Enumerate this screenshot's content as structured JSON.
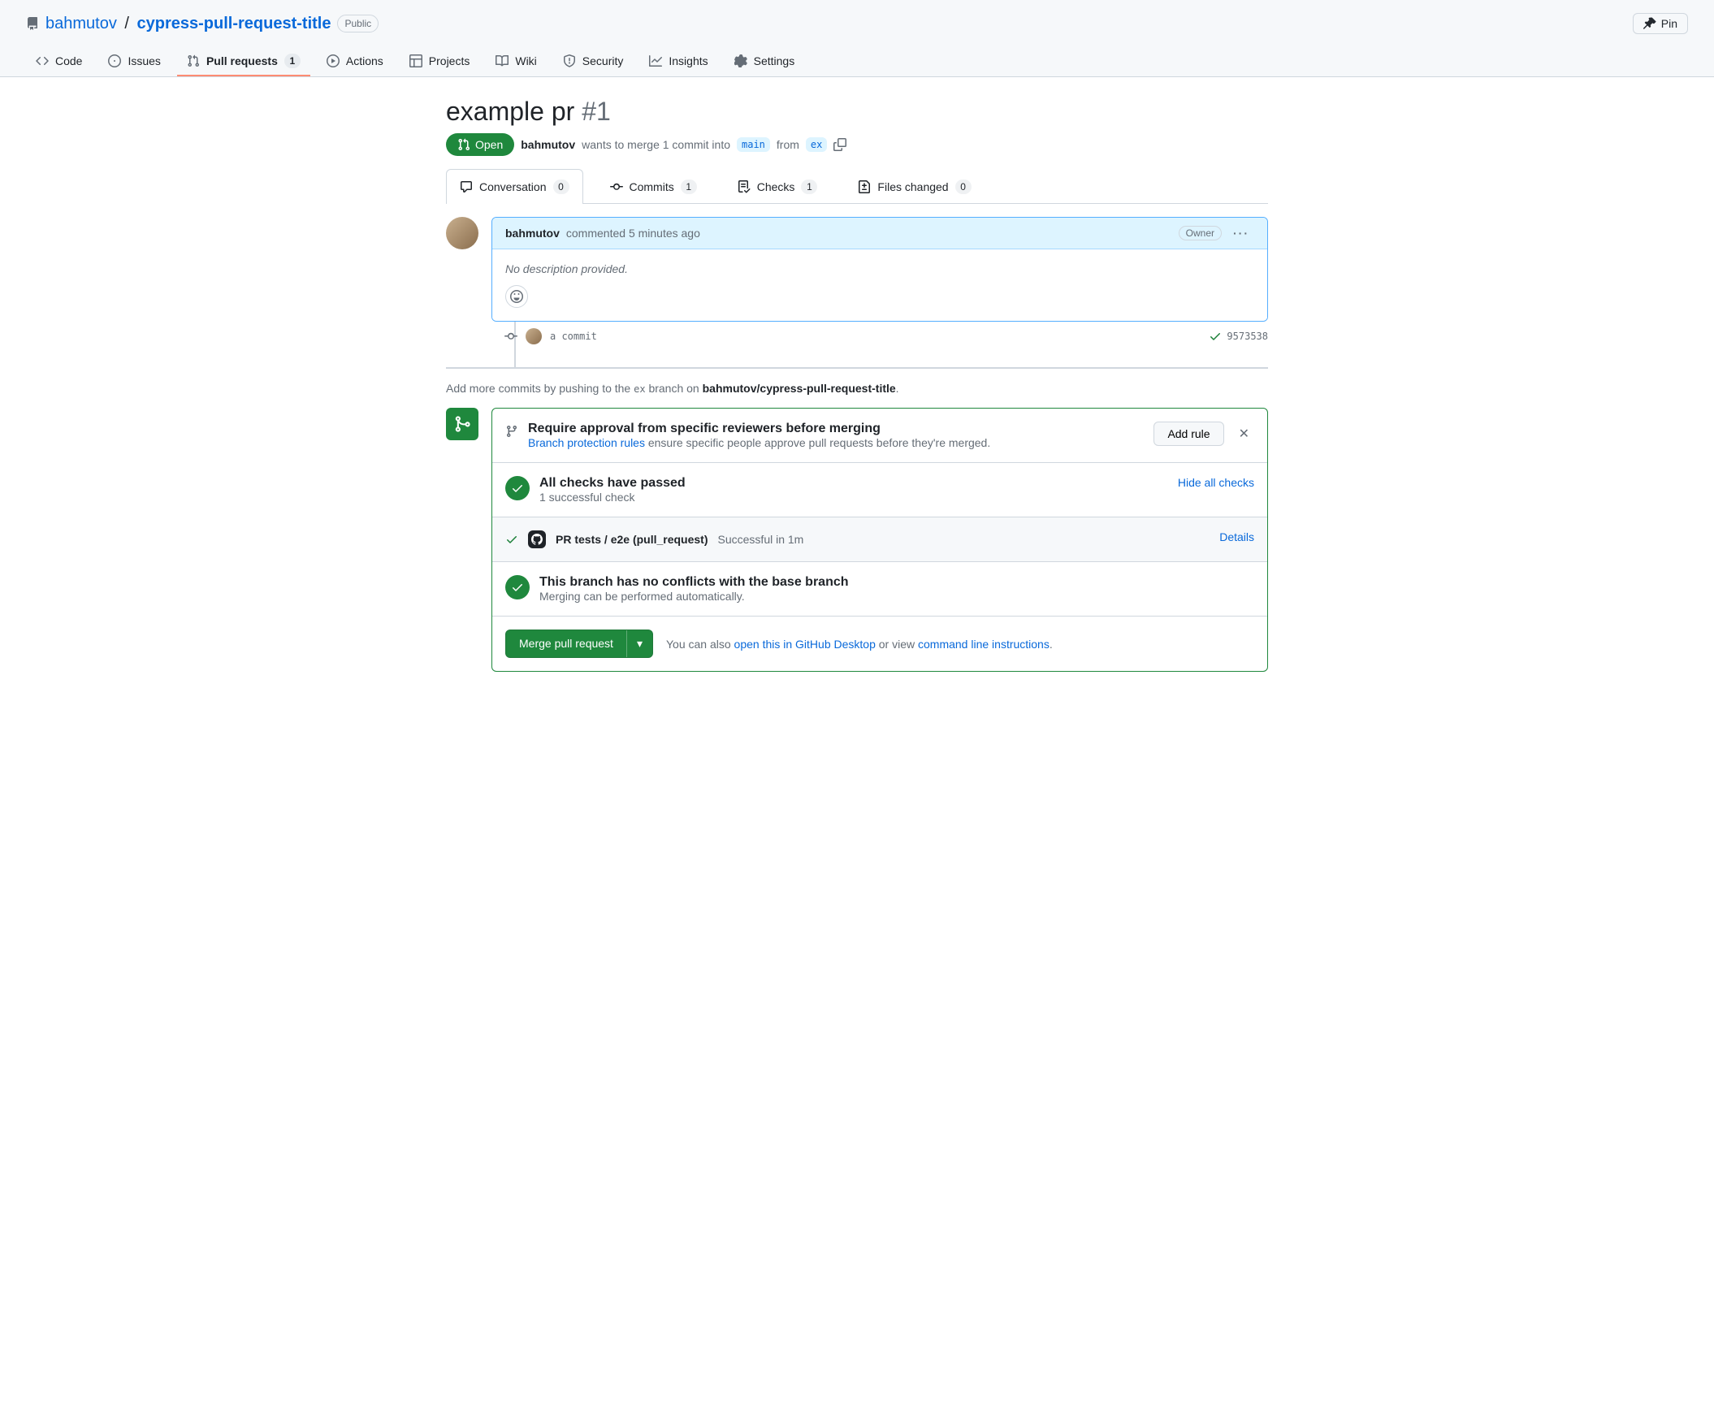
{
  "repo": {
    "owner": "bahmutov",
    "name": "cypress-pull-request-title",
    "visibility": "Public"
  },
  "header_actions": {
    "pin": "Pin"
  },
  "nav": {
    "code": "Code",
    "issues": "Issues",
    "pull_requests": "Pull requests",
    "pull_requests_count": "1",
    "actions": "Actions",
    "projects": "Projects",
    "wiki": "Wiki",
    "security": "Security",
    "insights": "Insights",
    "settings": "Settings"
  },
  "pr": {
    "title": "example pr",
    "number": "#1",
    "state": "Open",
    "author": "bahmutov",
    "merge_text_1": "wants to merge 1 commit into",
    "base": "main",
    "from": "from",
    "head": "ex"
  },
  "pr_tabs": {
    "conversation": "Conversation",
    "conversation_count": "0",
    "commits": "Commits",
    "commits_count": "1",
    "checks": "Checks",
    "checks_count": "1",
    "files": "Files changed",
    "files_count": "0"
  },
  "comment": {
    "author": "bahmutov",
    "action": "commented",
    "time": "5 minutes ago",
    "owner_badge": "Owner",
    "body": "No description provided."
  },
  "commit": {
    "message": "a commit",
    "sha": "9573538"
  },
  "push_hint": {
    "prefix": "Add more commits by pushing to the ",
    "branch": "ex",
    "middle": " branch on ",
    "repo": "bahmutov/cypress-pull-request-title",
    "suffix": "."
  },
  "merge_box": {
    "protect_title": "Require approval from specific reviewers before merging",
    "protect_link": "Branch protection rules",
    "protect_desc": " ensure specific people approve pull requests before they're merged.",
    "add_rule": "Add rule",
    "checks_title": "All checks have passed",
    "checks_sub": "1 successful check",
    "hide_checks": "Hide all checks",
    "check_name": "PR tests / e2e (pull_request)",
    "check_status": "Successful in 1m",
    "details": "Details",
    "no_conflicts_title": "This branch has no conflicts with the base branch",
    "no_conflicts_sub": "Merging can be performed automatically.",
    "merge_btn": "Merge pull request",
    "also_prefix": "You can also ",
    "desktop_link": "open this in GitHub Desktop",
    "also_middle": " or view ",
    "cli_link": "command line instructions",
    "also_suffix": "."
  }
}
